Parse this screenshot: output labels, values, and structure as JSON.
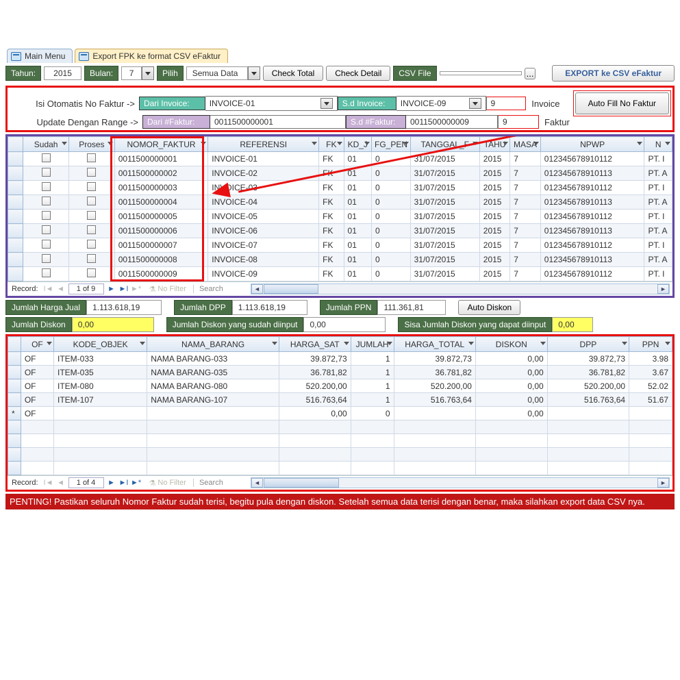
{
  "tabs": {
    "main": "Main Menu",
    "export": "Export FPK ke format CSV eFaktur"
  },
  "toolbar": {
    "tahun_lbl": "Tahun:",
    "tahun": "2015",
    "bulan_lbl": "Bulan:",
    "bulan": "7",
    "pilih_lbl": "Pilih",
    "pilih_val": "Semua Data",
    "check_total": "Check Total",
    "check_detail": "Check Detail",
    "csv_lbl": "CSV File",
    "csv_val": "",
    "browse": "...",
    "export": "EXPORT ke CSV eFaktur"
  },
  "range": {
    "row1_lbl": "Isi Otomatis No Faktur ->",
    "dari_inv_lbl": "Dari Invoice:",
    "dari_inv": "INVOICE-01",
    "sd_inv_lbl": "S.d Invoice:",
    "sd_inv": "INVOICE-09",
    "inv_count": "9",
    "inv_unit": "Invoice",
    "row2_lbl": "Update Dengan Range ->",
    "dari_fak_lbl": "Dari #Faktur:",
    "dari_fak": "0011500000001",
    "sd_fak_lbl": "S.d #Faktur:",
    "sd_fak": "0011500000009",
    "fak_count": "9",
    "fak_unit": "Faktur",
    "auto_fill": "Auto Fill No Faktur"
  },
  "grid1": {
    "headers": [
      "Sudah",
      "Proses",
      "NOMOR_FAKTUR",
      "REFERENSI",
      "FK",
      "KD_J",
      "FG_PEN",
      "TANGGAL_F",
      "TAHU",
      "MASA",
      "NPWP",
      "N"
    ],
    "rows": [
      {
        "nomor": "0011500000001",
        "ref": "INVOICE-01",
        "fk": "FK",
        "kd": "01",
        "fg": "0",
        "tgl": "31/07/2015",
        "th": "2015",
        "ms": "7",
        "npwp": "012345678910112",
        "n": "PT. I"
      },
      {
        "nomor": "0011500000002",
        "ref": "INVOICE-02",
        "fk": "FK",
        "kd": "01",
        "fg": "0",
        "tgl": "31/07/2015",
        "th": "2015",
        "ms": "7",
        "npwp": "012345678910113",
        "n": "PT. A"
      },
      {
        "nomor": "0011500000003",
        "ref": "INVOICE-03",
        "fk": "FK",
        "kd": "01",
        "fg": "0",
        "tgl": "31/07/2015",
        "th": "2015",
        "ms": "7",
        "npwp": "012345678910112",
        "n": "PT. I"
      },
      {
        "nomor": "0011500000004",
        "ref": "INVOICE-04",
        "fk": "FK",
        "kd": "01",
        "fg": "0",
        "tgl": "31/07/2015",
        "th": "2015",
        "ms": "7",
        "npwp": "012345678910113",
        "n": "PT. A"
      },
      {
        "nomor": "0011500000005",
        "ref": "INVOICE-05",
        "fk": "FK",
        "kd": "01",
        "fg": "0",
        "tgl": "31/07/2015",
        "th": "2015",
        "ms": "7",
        "npwp": "012345678910112",
        "n": "PT. I"
      },
      {
        "nomor": "0011500000006",
        "ref": "INVOICE-06",
        "fk": "FK",
        "kd": "01",
        "fg": "0",
        "tgl": "31/07/2015",
        "th": "2015",
        "ms": "7",
        "npwp": "012345678910113",
        "n": "PT. A"
      },
      {
        "nomor": "0011500000007",
        "ref": "INVOICE-07",
        "fk": "FK",
        "kd": "01",
        "fg": "0",
        "tgl": "31/07/2015",
        "th": "2015",
        "ms": "7",
        "npwp": "012345678910112",
        "n": "PT. I"
      },
      {
        "nomor": "0011500000008",
        "ref": "INVOICE-08",
        "fk": "FK",
        "kd": "01",
        "fg": "0",
        "tgl": "31/07/2015",
        "th": "2015",
        "ms": "7",
        "npwp": "012345678910113",
        "n": "PT. A"
      },
      {
        "nomor": "0011500000009",
        "ref": "INVOICE-09",
        "fk": "FK",
        "kd": "01",
        "fg": "0",
        "tgl": "31/07/2015",
        "th": "2015",
        "ms": "7",
        "npwp": "012345678910112",
        "n": "PT. I"
      }
    ],
    "rec_lbl": "Record:",
    "pos": "1 of 9",
    "nofilter": "No Filter",
    "search": "Search"
  },
  "sum1": {
    "hj_lbl": "Jumlah Harga Jual",
    "hj": "1.113.618,19",
    "dpp_lbl": "Jumlah DPP",
    "dpp": "1.113.618,19",
    "ppn_lbl": "Jumlah PPN",
    "ppn": "111.361,81",
    "auto_diskon": "Auto Diskon"
  },
  "sum2": {
    "jd_lbl": "Jumlah Diskon",
    "jd": "0,00",
    "jdi_lbl": "Jumlah Diskon yang sudah diinput",
    "jdi": "0,00",
    "sjd_lbl": "Sisa Jumlah Diskon yang dapat diinput",
    "sjd": "0,00"
  },
  "grid2": {
    "headers": [
      "OF",
      "KODE_OBJEK",
      "NAMA_BARANG",
      "HARGA_SAT",
      "JUMLAH",
      "HARGA_TOTAL",
      "DISKON",
      "DPP",
      "PPN"
    ],
    "rows": [
      {
        "of": "OF",
        "kode": "ITEM-033",
        "nama": "NAMA BARANG-033",
        "hs": "39.872,73",
        "jm": "1",
        "ht": "39.872,73",
        "disk": "0,00",
        "dpp": "39.872,73",
        "ppn": "3.98"
      },
      {
        "of": "OF",
        "kode": "ITEM-035",
        "nama": "NAMA BARANG-035",
        "hs": "36.781,82",
        "jm": "1",
        "ht": "36.781,82",
        "disk": "0,00",
        "dpp": "36.781,82",
        "ppn": "3.67"
      },
      {
        "of": "OF",
        "kode": "ITEM-080",
        "nama": "NAMA BARANG-080",
        "hs": "520.200,00",
        "jm": "1",
        "ht": "520.200,00",
        "disk": "0,00",
        "dpp": "520.200,00",
        "ppn": "52.02"
      },
      {
        "of": "OF",
        "kode": "ITEM-107",
        "nama": "NAMA BARANG-107",
        "hs": "516.763,64",
        "jm": "1",
        "ht": "516.763,64",
        "disk": "0,00",
        "dpp": "516.763,64",
        "ppn": "51.67"
      }
    ],
    "newrow": {
      "of": "OF",
      "hs": "0,00",
      "jm": "0",
      "disk": "0,00"
    },
    "rec_lbl": "Record:",
    "pos": "1 of 4",
    "nofilter": "No Filter",
    "search": "Search"
  },
  "footer": "PENTING! Pastikan seluruh Nomor Faktur sudah terisi, begitu pula dengan diskon. Setelah semua data terisi dengan benar, maka silahkan export data CSV nya."
}
